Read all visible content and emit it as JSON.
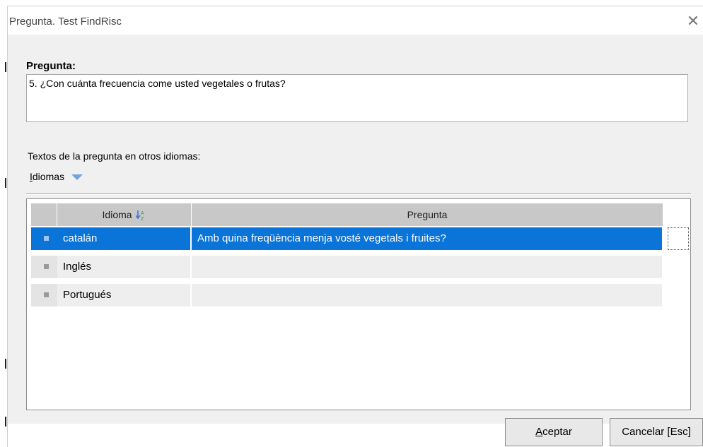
{
  "window": {
    "title": "Pregunta. Test FindRisc",
    "close_glyph": "✕"
  },
  "question": {
    "label": "Pregunta:",
    "text": "5. ¿Con cuánta frecuencia come usted vegetales o frutas?"
  },
  "other_languages": {
    "label": "Textos de la pregunta en otros idiomas:",
    "dropdown_first_letter": "I",
    "dropdown_rest": "diomas"
  },
  "grid": {
    "columns": [
      "Idioma",
      "Pregunta"
    ],
    "sort_icon": "sort-az-icon",
    "rows": [
      {
        "idioma": "catalán",
        "pregunta": "Amb quina freqüència menja vosté vegetals i fruites?",
        "selected": true
      },
      {
        "idioma": "Inglés",
        "pregunta": "",
        "selected": false
      },
      {
        "idioma": "Portugués",
        "pregunta": "",
        "selected": false
      }
    ]
  },
  "buttons": {
    "accept_first": "A",
    "accept_rest": "ceptar",
    "cancel": "Cancelar [Esc]"
  },
  "colors": {
    "selection": "#0a74d8",
    "dropdown_arrow": "#6fa4dd"
  }
}
